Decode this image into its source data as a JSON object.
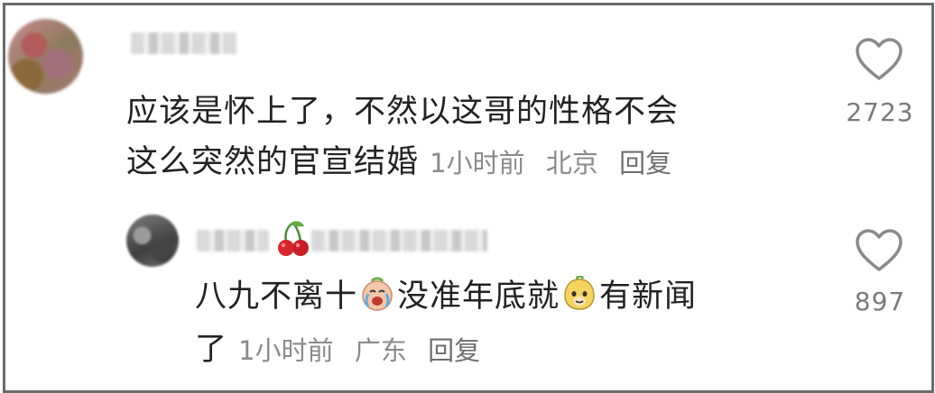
{
  "comments": [
    {
      "text_line1": "应该是怀上了，不然以这哥的性格不会",
      "text_line2": "这么突然的官宣结婚",
      "time": "1小时前",
      "location": "北京",
      "reply": "回复",
      "likes": "2723"
    },
    {
      "text_part1": "八九不离十",
      "text_part2": "没准年底就",
      "text_part3": "有新闻",
      "text_line2": "了",
      "time": "1小时前",
      "location": "广东",
      "reply": "回复",
      "likes": "897"
    }
  ],
  "icons": {
    "like": "heart-outline-icon",
    "emoji_1": "crying-emoji",
    "emoji_2": "smug-emoji",
    "username_badge": "cherry-icon"
  },
  "colors": {
    "text": "#222222",
    "meta": "#8a8a8a",
    "border": "#6b6b6b"
  }
}
